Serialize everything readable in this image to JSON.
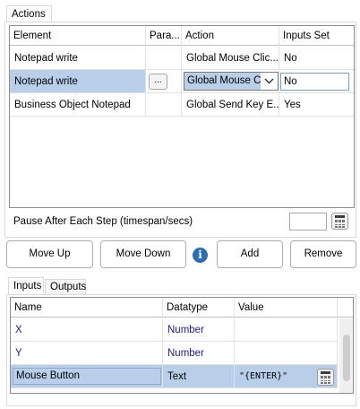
{
  "actions_tab": {
    "label": "Actions"
  },
  "actions_grid": {
    "headers": [
      "Element",
      "Para...",
      "Action",
      "Inputs Set"
    ],
    "rows": [
      {
        "element": "Notepad write",
        "action": "Global Mouse Clic...",
        "inputs_set": "No"
      },
      {
        "element": "Notepad write",
        "param_button": "...",
        "action": "Global Mouse C",
        "inputs_set": "No"
      },
      {
        "element": "Business Object Notepad",
        "action": "Global Send Key E...",
        "inputs_set": "Yes"
      }
    ]
  },
  "pause": {
    "label": "Pause After Each Step (timespan/secs)",
    "value": ""
  },
  "buttons": {
    "move_up": "Move Up",
    "move_down": "Move Down",
    "info": "i",
    "add": "Add",
    "remove": "Remove"
  },
  "bottom_tabs": {
    "inputs": "Inputs",
    "outputs": "Outputs"
  },
  "inputs_grid": {
    "headers": [
      "Name",
      "Datatype",
      "Value"
    ],
    "rows": [
      {
        "name": "X",
        "datatype": "Number",
        "value": ""
      },
      {
        "name": "Y",
        "datatype": "Number",
        "value": ""
      },
      {
        "name": "Mouse Button",
        "datatype": "Text",
        "value": "\"{ENTER}\""
      }
    ]
  },
  "colors": {
    "selection": "#b9cfe9",
    "link_text": "#1a1aa8",
    "info_icon": "#2a6fb5"
  }
}
